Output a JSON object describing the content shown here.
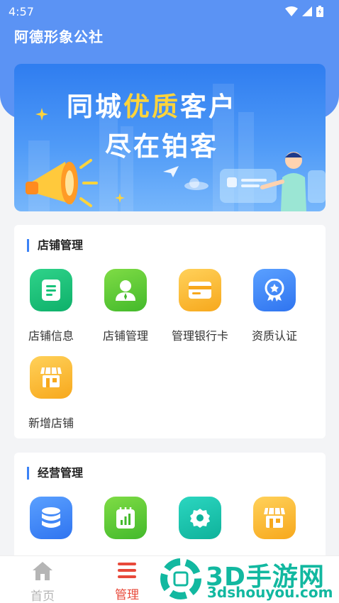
{
  "status_bar": {
    "time": "4:57"
  },
  "app": {
    "title": "阿德形象公社"
  },
  "banner": {
    "line1_pre": "同城",
    "line1_highlight": "优质",
    "line1_post": "客户",
    "line2": "尽在铂客"
  },
  "shop_section": {
    "title": "店铺管理",
    "items": [
      {
        "label": "店铺信息",
        "icon": "document-icon",
        "color": "#17c27a"
      },
      {
        "label": "店铺管理",
        "icon": "person-icon",
        "color": "#5fcb37"
      },
      {
        "label": "管理银行卡",
        "icon": "card-icon",
        "color": "#fbbd36"
      },
      {
        "label": "资质认证",
        "icon": "badge-icon",
        "color": "#3f86f7"
      },
      {
        "label": "新增店铺",
        "icon": "store-icon",
        "color": "#fbbd36"
      }
    ]
  },
  "business_section": {
    "title": "经营管理",
    "items": [
      {
        "icon": "database-icon",
        "color": "#3f86f7"
      },
      {
        "icon": "chart-icon",
        "color": "#5fcb37"
      },
      {
        "icon": "settings-icon",
        "color": "#17c4ad"
      },
      {
        "icon": "store-icon",
        "color": "#fbbd36"
      }
    ]
  },
  "bottom_nav": {
    "items": [
      {
        "label": "首页",
        "icon": "home-icon",
        "active": false
      },
      {
        "label": "管理",
        "icon": "menu-icon",
        "active": true
      }
    ],
    "active_color": "#e8493a",
    "inactive_color": "#b5b5b5"
  },
  "watermark": {
    "text": "3D手游网",
    "url": "3dshouyou.com"
  }
}
